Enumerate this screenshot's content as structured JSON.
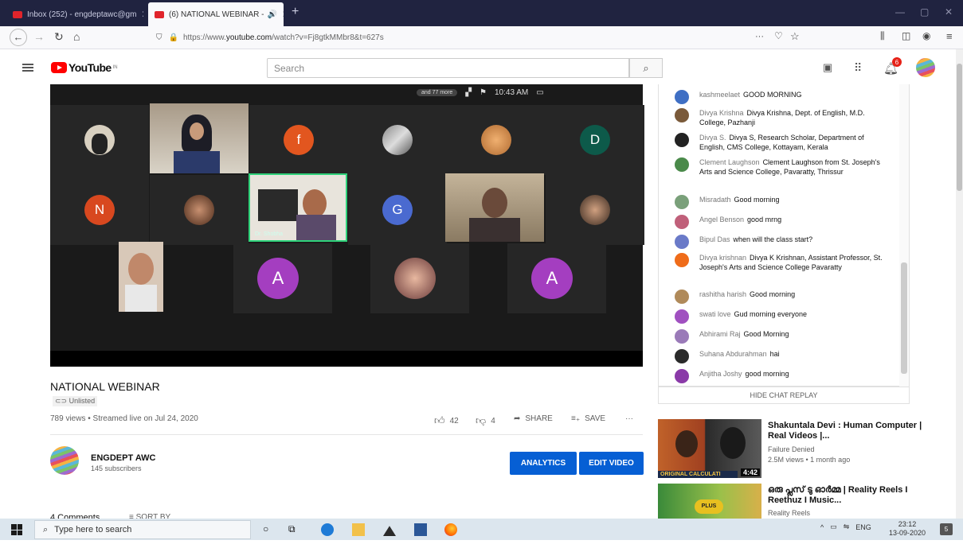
{
  "browser": {
    "tabs": [
      {
        "label": "Inbox (252) - engdeptawc@gm",
        "close": "✕"
      },
      {
        "label": "(6) NATIONAL WEBINAR -",
        "close": "✕",
        "sound": "🔊"
      }
    ],
    "new_tab": "+",
    "url_prefix": "https://www.",
    "url_domain": "youtube.com",
    "url_rest": "/watch?v=Fj8gtkMMbr8&t=627s",
    "page_actions": "···"
  },
  "youtube": {
    "logo": "YouTube",
    "logo_region": "IN",
    "search_placeholder": "Search",
    "notif_count": "6"
  },
  "video": {
    "zoom_top_label": "and 77 more",
    "zoom_time": "10:43 AM",
    "tile_letters": {
      "f": "f",
      "D": "D",
      "N": "N",
      "G": "G",
      "A1": "A",
      "A2": "A"
    },
    "tile_name": "Dr. Shobha"
  },
  "info": {
    "title": "NATIONAL WEBINAR",
    "unlisted": "Unlisted",
    "views": "789 views • Streamed live on Jul 24, 2020",
    "likes": "42",
    "dislikes": "4",
    "share": "SHARE",
    "save": "SAVE",
    "more": "···",
    "channel_name": "ENGDEPT AWC",
    "subscribers": "145 subscribers",
    "analytics": "ANALYTICS",
    "edit_video": "EDIT VIDEO",
    "comments": "4 Comments",
    "sort_by": "SORT BY"
  },
  "chat": {
    "messages": [
      {
        "author": "kashmeelaet",
        "text": "GOOD MORNING",
        "color": "#3f6fc4"
      },
      {
        "author": "Divya Krishna",
        "text": "Divya Krishna, Dept. of English, M.D. College, Pazhanji",
        "color": "#7a5a3a"
      },
      {
        "author": "Divya S.",
        "text": "Divya S, Research Scholar, Department of English, CMS College, Kottayam, Kerala",
        "color": "#222222"
      },
      {
        "author": "Clement Laughson",
        "text": "Clement Laughson from St. Joseph's Arts and Science College, Pavaratty, Thrissur",
        "color": "#4a8a4a"
      },
      {
        "author": "Misradath",
        "text": "Good morning",
        "color": "#7aa07a"
      },
      {
        "author": "Angel Benson",
        "text": "good mrng",
        "color": "#c0607a"
      },
      {
        "author": "Bipul Das",
        "text": "when will the class start?",
        "color": "#6a7ac8"
      },
      {
        "author": "Divya krishnan",
        "text": "Divya K Krishnan, Assistant Professor, St. Joseph's Arts and Science College Pavaratty",
        "color": "#ef6c1a"
      },
      {
        "author": "rashitha harish",
        "text": "Good morning",
        "color": "#b08a5a"
      },
      {
        "author": "swati love",
        "text": "Gud morning everyone",
        "color": "#a050c0"
      },
      {
        "author": "Abhirami Raj",
        "text": "Good Morning",
        "color": "#9a7ab8"
      },
      {
        "author": "Suhana Abdurahman",
        "text": "hai",
        "color": "#2a2a2a"
      },
      {
        "author": "Anjitha Joshy",
        "text": "good morning",
        "color": "#8a3aa8"
      }
    ],
    "hide": "HIDE CHAT REPLAY"
  },
  "related": [
    {
      "title": "Shakuntala Devi : Human Computer | Real Videos |...",
      "channel": "Failure Denied",
      "meta": "2.5M views • 1 month ago",
      "duration": "4:42",
      "thumb_text": "ORIGINAL CALCULATI"
    },
    {
      "title": "ഒരു പ്ലസ്‌ ടു ഓർമ്മ | Reality Reels I Reethuz I Music...",
      "channel": "Reality Reels",
      "meta": "",
      "duration": "",
      "thumb_text": "PLUS"
    }
  ],
  "taskbar": {
    "search": "Type here to search",
    "lang": "ENG",
    "time": "23:12",
    "date": "13-09-2020",
    "notif": "5"
  },
  "colors": {
    "yt_red": "#ff0000",
    "blue_button": "#065fd4",
    "tabbar": "#202340"
  }
}
